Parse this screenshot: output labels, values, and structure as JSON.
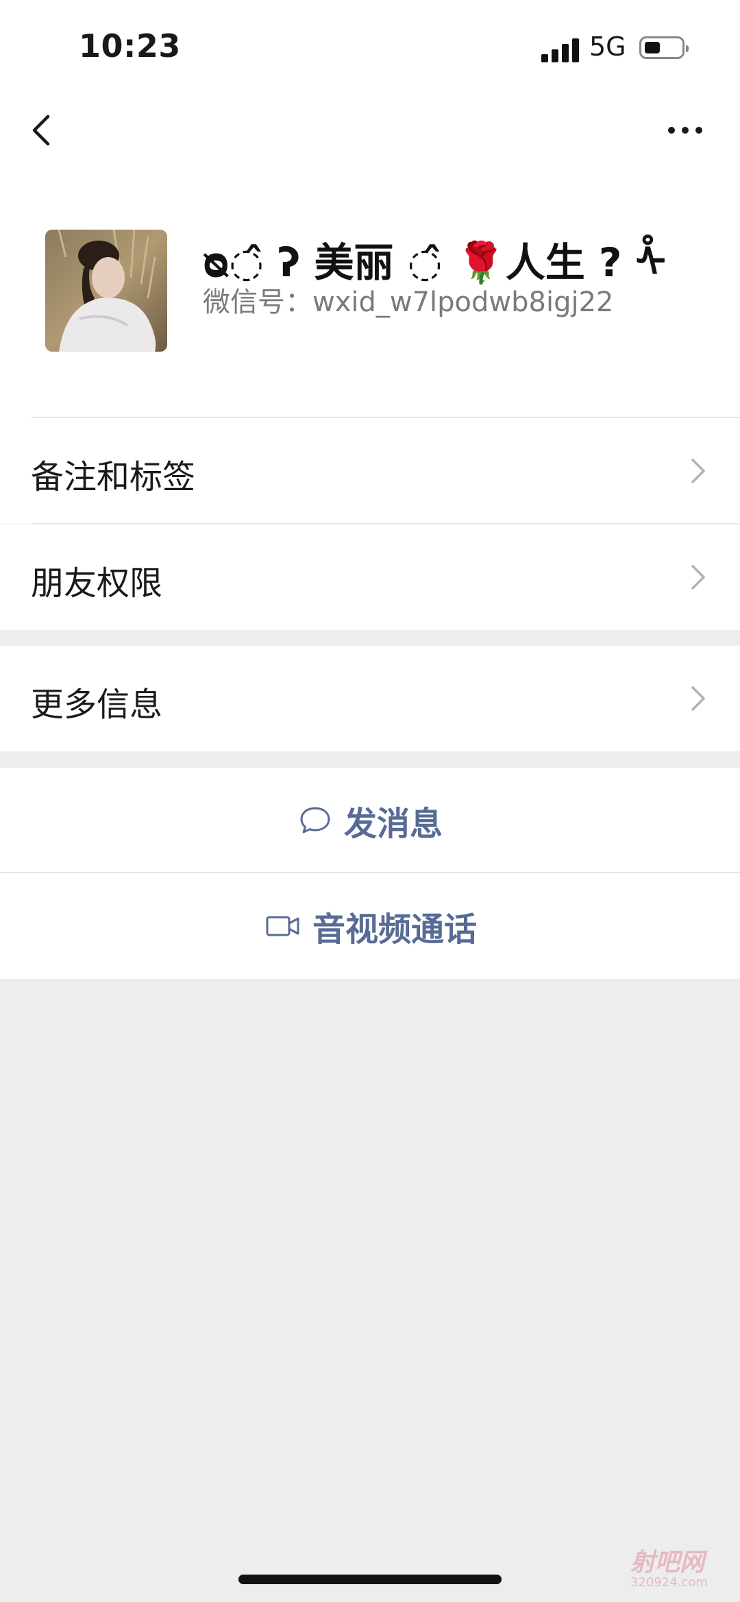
{
  "status_bar": {
    "time": "10:23",
    "network": "5G"
  },
  "profile": {
    "nickname": "ᴓ◌̂ ʔ 美丽 ◌̂ 🌹人生 ? ᢥ",
    "wechat_id": "微信号：wxid_w7lpodwb8igj22"
  },
  "menu": {
    "remarks_tags": "备注和标签",
    "friend_permissions": "朋友权限",
    "more_info": "更多信息"
  },
  "actions": {
    "send_message": "发消息",
    "video_call": "音视频通话"
  },
  "watermark": {
    "brand": "射吧网",
    "site": "320924.com"
  },
  "colors": {
    "link": "#576b95",
    "background": "#ededed"
  }
}
